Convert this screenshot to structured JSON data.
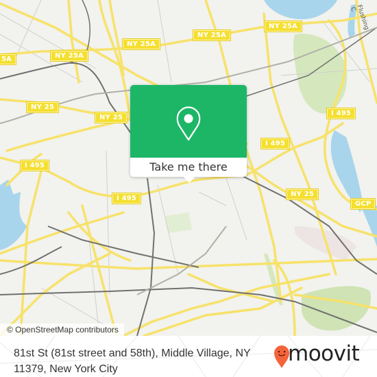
{
  "map": {
    "shields": [
      {
        "id": "ny25a-left-edge",
        "label": "5A"
      },
      {
        "id": "ny25a-1",
        "label": "NY 25A"
      },
      {
        "id": "ny25a-2",
        "label": "NY 25A"
      },
      {
        "id": "ny25a-3",
        "label": "NY 25A"
      },
      {
        "id": "ny25a-4",
        "label": "NY 25A"
      },
      {
        "id": "ny25-1",
        "label": "NY 25"
      },
      {
        "id": "ny25-2",
        "label": "NY 25"
      },
      {
        "id": "ny25-3",
        "label": "NY 25"
      },
      {
        "id": "i495-1",
        "label": "I 495"
      },
      {
        "id": "i495-2",
        "label": "I 495"
      },
      {
        "id": "i495-3",
        "label": "I 495"
      },
      {
        "id": "i495-4",
        "label": "I 495"
      },
      {
        "id": "gcp",
        "label": "GCP"
      }
    ],
    "water_label": "Flushing C",
    "colors": {
      "land": "#f2f2ee",
      "road_major": "#f7e26b",
      "water": "#a8d5ec",
      "park": "#d5e8bd",
      "rail": "#707070"
    }
  },
  "popup": {
    "action_label": "Take me there",
    "accent_color": "#1db667"
  },
  "attribution": "© OpenStreetMap contributors",
  "footer": {
    "address": "81st St (81st street and 58th), Middle Village, NY 11379, New York City",
    "brand": "moovit",
    "brand_color": "#f4643b"
  }
}
